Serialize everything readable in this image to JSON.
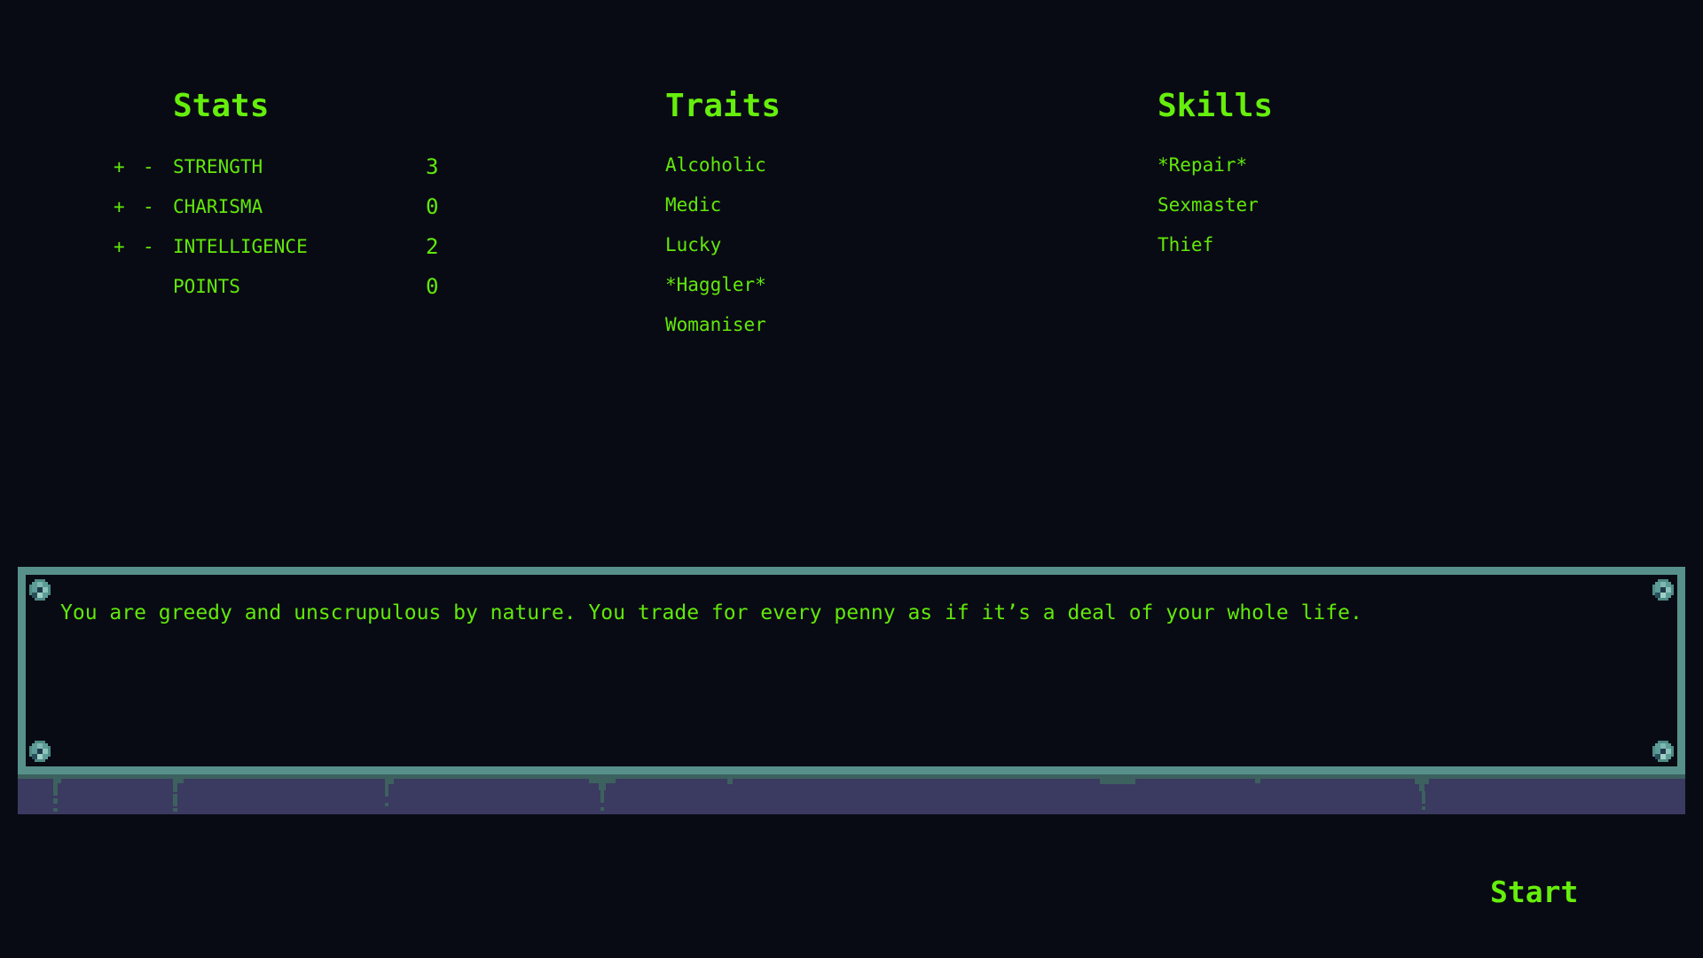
{
  "colors": {
    "background": "#080b14",
    "text": "#62e80a",
    "frame_border": "#57908a",
    "frame_base": "#3b3a60",
    "frame_drip": "#3c615f"
  },
  "stats": {
    "title": "Stats",
    "increment_label": "+",
    "decrement_label": "-",
    "rows": [
      {
        "label": "STRENGTH",
        "value": "3"
      },
      {
        "label": "CHARISMA",
        "value": "0"
      },
      {
        "label": "INTELLIGENCE",
        "value": "2"
      }
    ],
    "points": {
      "label": "POINTS",
      "value": "0"
    }
  },
  "traits": {
    "title": "Traits",
    "items": [
      "Alcoholic",
      "Medic",
      "Lucky",
      "*Haggler*",
      "Womaniser"
    ]
  },
  "skills": {
    "title": "Skills",
    "items": [
      "*Repair*",
      "Sexmaster",
      "Thief"
    ]
  },
  "description": {
    "text": "You are greedy and unscrupulous by nature. You trade for every penny as if it’s a deal of your whole life."
  },
  "actions": {
    "start_label": "Start"
  }
}
